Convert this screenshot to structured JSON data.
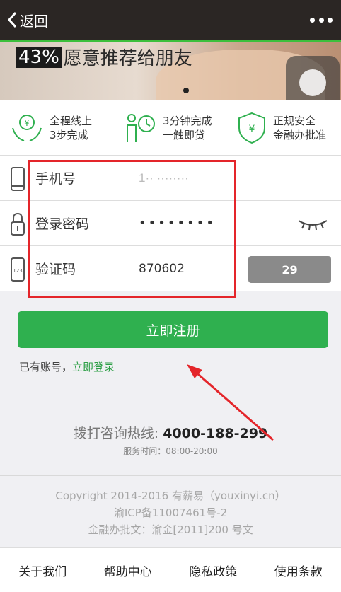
{
  "navbar": {
    "back_label": "返回"
  },
  "banner": {
    "percent": "43%",
    "text": "愿意推荐给朋友"
  },
  "features": [
    {
      "line1": "全程线上",
      "line2": "3步完成"
    },
    {
      "line1": "3分钟完成",
      "line2": "一触即贷"
    },
    {
      "line1": "正规安全",
      "line2": "金融办批准"
    }
  ],
  "form": {
    "phone_label": "手机号",
    "phone_value": "1·· ········",
    "password_label": "登录密码",
    "password_value": "••••••••",
    "code_label": "验证码",
    "code_value": "870602",
    "code_button": "29"
  },
  "register_button": "立即注册",
  "login_prompt": "已有账号，",
  "login_link": "立即登录",
  "hotline": {
    "label": "拨打咨询热线: ",
    "number": "4000-188-299",
    "hours": "服务时间：08:00-20:00"
  },
  "copyright": {
    "line1": "Copyright 2014-2016 有薪易（youxinyi.cn）",
    "line2": "渝ICP备11007461号-2",
    "line3": "金融办批文：渝金[2011]200 号文"
  },
  "footer": {
    "about": "关于我们",
    "help": "帮助中心",
    "privacy": "隐私政策",
    "terms": "使用条款"
  },
  "colors": {
    "accent": "#2fb04f",
    "annotation": "#e4252a",
    "navbar": "#2b2624"
  }
}
